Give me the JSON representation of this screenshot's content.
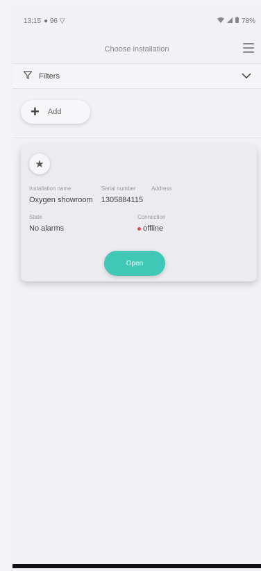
{
  "status": {
    "time": "13:15",
    "left_icons": "● 96 ▽",
    "right_text": "78%"
  },
  "header": {
    "title": "Choose installation"
  },
  "filters": {
    "label": "Filters"
  },
  "add": {
    "label": "Add"
  },
  "card": {
    "installation_name_label": "Installation name",
    "installation_name": "Oxygen showroom",
    "serial_label": "Serial number",
    "serial": "1305884115",
    "address_label": "Address",
    "address": "",
    "state_label": "State",
    "state": "No alarms",
    "connection_label": "Connection",
    "connection": "offline",
    "open_label": "Open"
  },
  "colors": {
    "accent": "#3fc8b6",
    "offline_dot": "#e05050"
  }
}
